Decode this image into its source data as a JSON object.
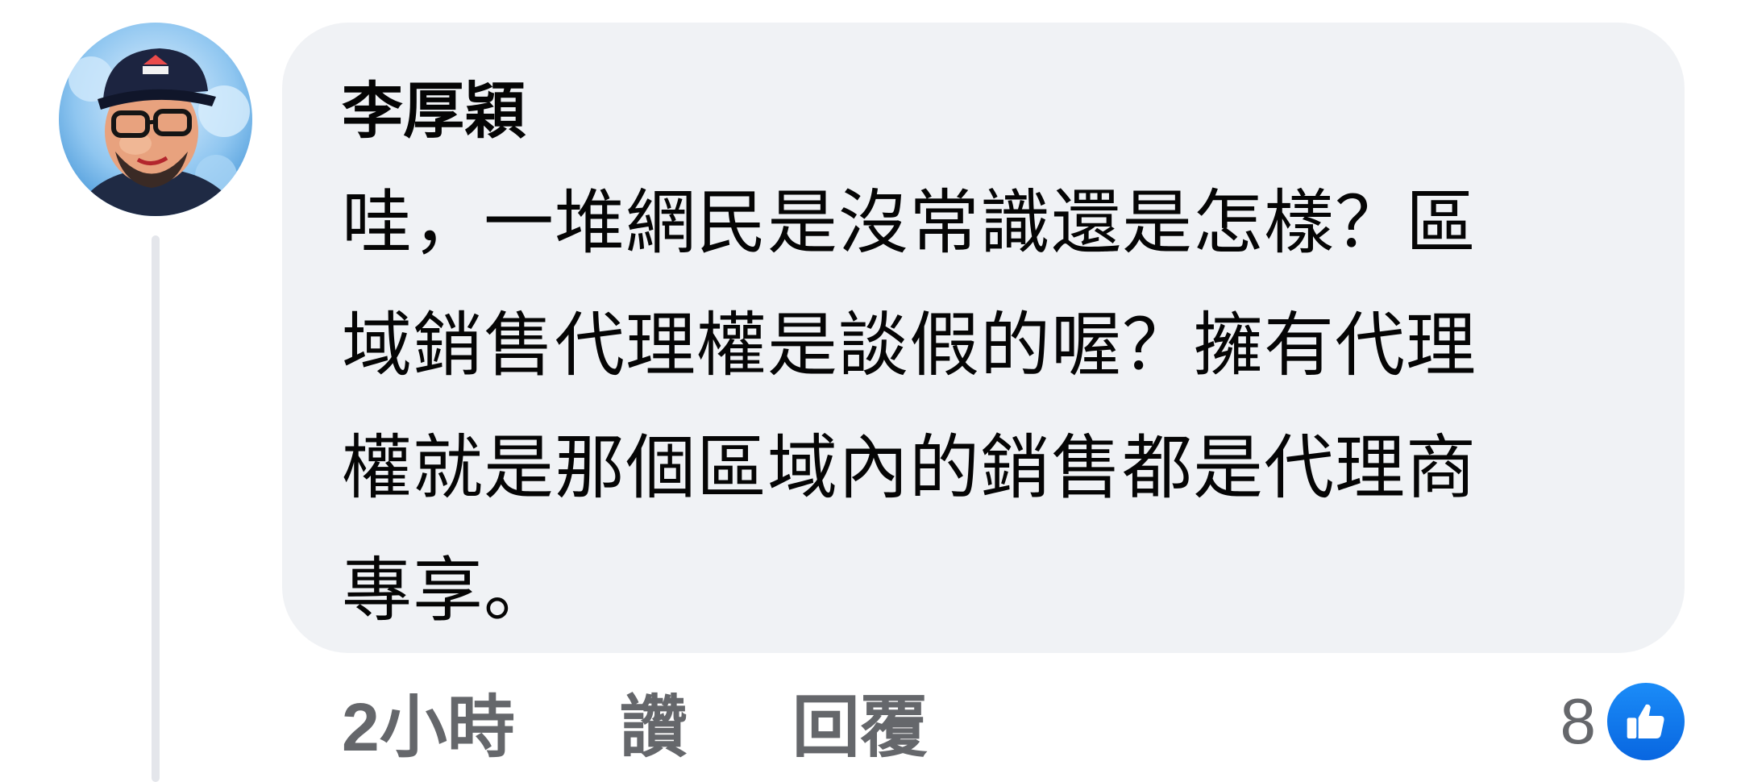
{
  "comment": {
    "author": "李厚穎",
    "text_lines": [
      "哇，一堆網民是沒常識還是怎樣？區",
      "域銷售代理權是談假的喔？擁有代理",
      "權就是那個區域內的銷售都是代理商",
      "專享。"
    ],
    "timestamp": "2小時",
    "like_label": "讚",
    "reply_label": "回覆",
    "reaction_count": "8",
    "reaction_icon": "thumbs-up-icon",
    "avatar_icon": "user-avatar"
  },
  "colors": {
    "bubble_background": "#f0f2f5",
    "meta_text": "#65676b",
    "like_blue": "#1877f2"
  }
}
